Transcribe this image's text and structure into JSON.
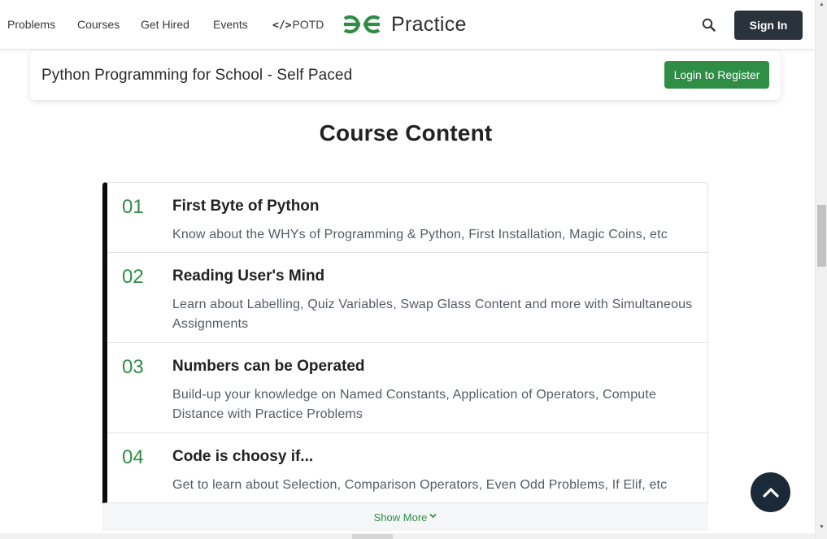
{
  "nav": {
    "items": [
      {
        "label": "Problems"
      },
      {
        "label": "Courses"
      },
      {
        "label": "Get Hired"
      },
      {
        "label": "Events"
      },
      {
        "label": "POTD",
        "icon": "code-icon",
        "icon_text": "</>"
      }
    ],
    "logo_text": "Practice",
    "search_icon": "search-icon",
    "sign_in": "Sign In"
  },
  "course": {
    "title": "Python Programming for School - Self Paced",
    "register_label": "Login to Register"
  },
  "content": {
    "heading": "Course Content",
    "items": [
      {
        "num": "01",
        "title": "First Byte of Python",
        "desc": "Know about the WHYs of Programming & Python, First Installation, Magic Coins, etc"
      },
      {
        "num": "02",
        "title": "Reading User's Mind",
        "desc": "Learn about Labelling, Quiz Variables, Swap Glass Content and more with Simultaneous Assignments"
      },
      {
        "num": "03",
        "title": "Numbers can be Operated",
        "desc": "Build-up your knowledge on Named Constants, Application of Operators, Compute Distance with Practice Problems"
      },
      {
        "num": "04",
        "title": "Code is choosy if...",
        "desc": "Get to learn about Selection, Comparison Operators, Even Odd Problems, If Elif, etc"
      }
    ],
    "show_more": "Show More"
  },
  "colors": {
    "brand_green": "#2f8d46",
    "dark_button": "#2a323c",
    "scroll_top_bg": "#1b2a38"
  }
}
